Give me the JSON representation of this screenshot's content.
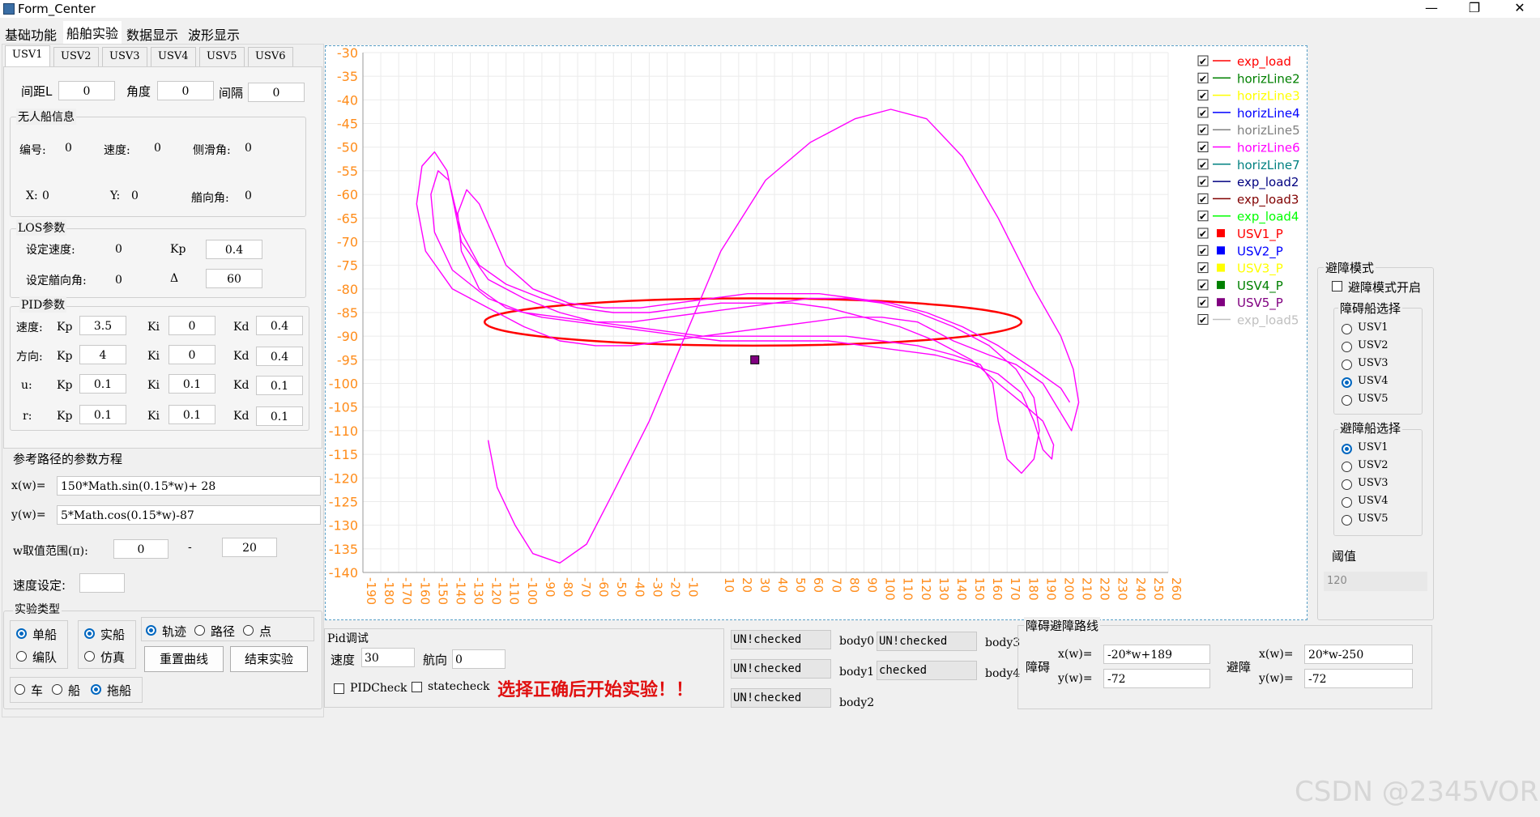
{
  "window": {
    "title": "Form_Center",
    "minimize": "—",
    "maximize": "❐",
    "close": "✕"
  },
  "menu": [
    "基础功能",
    "船舶实验",
    "数据显示",
    "波形显示"
  ],
  "usv_tabs": [
    "USV1",
    "USV2",
    "USV3",
    "USV4",
    "USV5",
    "USV6"
  ],
  "spacing": {
    "l_label": "间距L",
    "l_value": "0",
    "angle_label": "角度",
    "angle_value": "0",
    "interval_label": "间隔",
    "interval_value": "0"
  },
  "usv_info": {
    "title": "无人船信息",
    "id_label": "编号:",
    "id_value": "0",
    "speed_label": "速度:",
    "speed_value": "0",
    "slip_label": "侧滑角:",
    "slip_value": "0",
    "x_label": "X:",
    "x_value": "0",
    "y_label": "Y:",
    "y_value": "0",
    "heading_label": "艏向角:",
    "heading_value": "0"
  },
  "los": {
    "title": "LOS参数",
    "set_speed_label": "设定速度:",
    "set_speed_value": "0",
    "kp_label": "Kp",
    "kp_value": "0.4",
    "set_heading_label": "设定艏向角:",
    "set_heading_value": "0",
    "delta_label": "Δ",
    "delta_value": "60"
  },
  "pid": {
    "title": "PID参数",
    "rows": [
      {
        "name": "速度:",
        "kp": "3.5",
        "ki": "0",
        "kd": "0.4"
      },
      {
        "name": "方向:",
        "kp": "4",
        "ki": "0",
        "kd": "0.4"
      },
      {
        "name": "u:",
        "kp": "0.1",
        "ki": "0.1",
        "kd": "0.1"
      },
      {
        "name": "r:",
        "kp": "0.1",
        "ki": "0.1",
        "kd": "0.1"
      }
    ],
    "kp_label": "Kp",
    "ki_label": "Ki",
    "kd_label": "Kd"
  },
  "ref_path": {
    "title": "参考路径的参数方程",
    "x_label": "x(w)=",
    "x_value": "150*Math.sin(0.15*w)+ 28",
    "y_label": "y(w)=",
    "y_value": "5*Math.cos(0.15*w)-87",
    "w_label": "w取值范围(π):",
    "w_from": "0",
    "w_dash": "-",
    "w_to": "20",
    "speed_label": "速度设定:",
    "speed_value": ""
  },
  "exp_type": {
    "title": "实验类型",
    "single": "单船",
    "formation": "编队",
    "real": "实船",
    "sim": "仿真",
    "trajectory": "轨迹",
    "path": "路径",
    "point": "点",
    "reset_button": "重置曲线",
    "end_button": "结束实验",
    "car": "车",
    "ship": "船",
    "tug": "拖船"
  },
  "pid_debug": {
    "title": "Pid调试",
    "speed_label": "速度",
    "speed_value": "30",
    "heading_label": "航向",
    "heading_value": "0",
    "pidcheck": "PIDCheck",
    "statecheck": "statecheck",
    "warning": "选择正确后开始实验！！"
  },
  "bodies": [
    {
      "status": "UN!checked",
      "label": "body0"
    },
    {
      "status": "UN!checked",
      "label": "body1"
    },
    {
      "status": "UN!checked",
      "label": "body2"
    },
    {
      "status": "UN!checked",
      "label": "body3"
    },
    {
      "status": "checked",
      "label": "body4"
    }
  ],
  "obstacle_path": {
    "title": "障碍避障路线",
    "obs_label": "障碍",
    "obs_x_label": "x(w)=",
    "obs_x_value": "-20*w+189",
    "obs_y_label": "y(w)=",
    "obs_y_value": "-72",
    "avoid_label": "避障",
    "avoid_x_label": "x(w)=",
    "avoid_x_value": "20*w-250",
    "avoid_y_label": "y(w)=",
    "avoid_y_value": "-72"
  },
  "avoid_mode": {
    "title": "避障模式",
    "enable": "避障模式开启",
    "obstacle_ship_title": "障碍船选择",
    "obstacle_ships": [
      "USV1",
      "USV2",
      "USV3",
      "USV4",
      "USV5"
    ],
    "obstacle_selected": 3,
    "avoid_ship_title": "避障船选择",
    "avoid_ships": [
      "USV1",
      "USV2",
      "USV3",
      "USV4",
      "USV5"
    ],
    "avoid_selected": 0,
    "threshold_label": "阈值",
    "threshold_value": "120"
  },
  "watermark": "CSDN @2345VOR",
  "chart_data": {
    "type": "line",
    "xlim": [
      -190,
      260
    ],
    "ylim": [
      -140,
      -30
    ],
    "x_ticks": [
      -190,
      -180,
      -170,
      -160,
      -150,
      -140,
      -130,
      -120,
      -110,
      -100,
      -90,
      -80,
      -70,
      -60,
      -50,
      -40,
      -30,
      -20,
      -10,
      10,
      20,
      30,
      40,
      50,
      60,
      70,
      80,
      90,
      100,
      110,
      120,
      130,
      140,
      150,
      160,
      170,
      180,
      190,
      200,
      210,
      220,
      230,
      240,
      250,
      260
    ],
    "y_ticks": [
      -30,
      -35,
      -40,
      -45,
      -50,
      -55,
      -60,
      -65,
      -70,
      -75,
      -80,
      -85,
      -90,
      -95,
      -100,
      -105,
      -110,
      -115,
      -120,
      -125,
      -130,
      -135,
      -140
    ],
    "tick_color": "#ff8c1a",
    "legend": [
      {
        "name": "exp_load",
        "color": "#ff0000",
        "kind": "line"
      },
      {
        "name": "horizLine2",
        "color": "#008000",
        "kind": "line"
      },
      {
        "name": "horizLine3",
        "color": "#ffff00",
        "kind": "line"
      },
      {
        "name": "horizLine4",
        "color": "#0000ff",
        "kind": "line"
      },
      {
        "name": "horizLine5",
        "color": "#808080",
        "kind": "line"
      },
      {
        "name": "horizLine6",
        "color": "#ff00ff",
        "kind": "line"
      },
      {
        "name": "horizLine7",
        "color": "#008080",
        "kind": "line"
      },
      {
        "name": "exp_load2",
        "color": "#000080",
        "kind": "line"
      },
      {
        "name": "exp_load3",
        "color": "#800000",
        "kind": "line"
      },
      {
        "name": "exp_load4",
        "color": "#00ff00",
        "kind": "line"
      },
      {
        "name": "USV1_P",
        "color": "#ff0000",
        "kind": "box"
      },
      {
        "name": "USV2_P",
        "color": "#0000ff",
        "kind": "box"
      },
      {
        "name": "USV3_P",
        "color": "#ffff00",
        "kind": "box"
      },
      {
        "name": "USV4_P",
        "color": "#008000",
        "kind": "box"
      },
      {
        "name": "USV5_P",
        "color": "#800080",
        "kind": "box"
      },
      {
        "name": "exp_load5",
        "color": "#c0c0c0",
        "kind": "line"
      }
    ],
    "series": [
      {
        "name": "exp_load",
        "color": "#ff0000",
        "shape": "ellipse",
        "center": [
          28,
          -87
        ],
        "rx": 150,
        "ry": 5
      },
      {
        "name": "horizLine6",
        "color": "#ff00ff",
        "points": [
          [
            -120,
            -112
          ],
          [
            -115,
            -122
          ],
          [
            -105,
            -130
          ],
          [
            -95,
            -136
          ],
          [
            -80,
            -138
          ],
          [
            -65,
            -134
          ],
          [
            -50,
            -123
          ],
          [
            -30,
            -108
          ],
          [
            -10,
            -90
          ],
          [
            10,
            -72
          ],
          [
            35,
            -57
          ],
          [
            60,
            -49
          ],
          [
            85,
            -44
          ],
          [
            105,
            -42
          ],
          [
            125,
            -44
          ],
          [
            145,
            -52
          ],
          [
            165,
            -65
          ],
          [
            185,
            -80
          ],
          [
            200,
            -90
          ],
          [
            207,
            -97
          ],
          [
            210,
            -104
          ],
          [
            206,
            -110
          ],
          [
            198,
            -105
          ],
          [
            190,
            -100
          ],
          [
            175,
            -96
          ],
          [
            160,
            -94
          ],
          [
            140,
            -91
          ],
          [
            120,
            -87
          ],
          [
            100,
            -86
          ],
          [
            80,
            -86
          ],
          [
            60,
            -87
          ],
          [
            40,
            -88
          ],
          [
            20,
            -89
          ],
          [
            0,
            -90
          ],
          [
            -20,
            -91
          ],
          [
            -40,
            -92
          ],
          [
            -60,
            -92
          ],
          [
            -80,
            -91
          ],
          [
            -100,
            -88
          ],
          [
            -120,
            -84
          ],
          [
            -140,
            -80
          ],
          [
            -155,
            -72
          ],
          [
            -160,
            -62
          ],
          [
            -157,
            -54
          ],
          [
            -150,
            -51
          ],
          [
            -143,
            -55
          ],
          [
            -135,
            -70
          ],
          [
            -120,
            -78
          ],
          [
            -100,
            -82
          ],
          [
            -80,
            -85
          ],
          [
            -60,
            -87
          ],
          [
            -40,
            -87
          ],
          [
            -20,
            -86
          ],
          [
            0,
            -85
          ],
          [
            20,
            -84
          ],
          [
            40,
            -83
          ],
          [
            60,
            -82
          ],
          [
            80,
            -82
          ],
          [
            100,
            -83
          ],
          [
            120,
            -85
          ],
          [
            140,
            -88
          ],
          [
            160,
            -92
          ],
          [
            175,
            -97
          ],
          [
            185,
            -103
          ],
          [
            188,
            -110
          ],
          [
            185,
            -116
          ],
          [
            178,
            -119
          ],
          [
            170,
            -116
          ],
          [
            165,
            -108
          ],
          [
            162,
            -100
          ],
          [
            155,
            -96
          ],
          [
            140,
            -94
          ],
          [
            120,
            -92
          ],
          [
            100,
            -91
          ],
          [
            80,
            -90
          ],
          [
            60,
            -90
          ],
          [
            40,
            -90
          ],
          [
            20,
            -90
          ],
          [
            0,
            -90
          ],
          [
            -20,
            -89
          ],
          [
            -40,
            -88
          ],
          [
            -60,
            -87
          ],
          [
            -80,
            -86
          ],
          [
            -100,
            -85
          ],
          [
            -120,
            -82
          ],
          [
            -140,
            -76
          ],
          [
            -150,
            -68
          ],
          [
            -152,
            -60
          ],
          [
            -148,
            -55
          ],
          [
            -142,
            -57
          ],
          [
            -135,
            -68
          ],
          [
            -125,
            -75
          ],
          [
            -110,
            -79
          ],
          [
            -90,
            -82
          ],
          [
            -70,
            -84
          ],
          [
            -50,
            -85
          ],
          [
            -30,
            -85
          ],
          [
            -10,
            -84
          ],
          [
            10,
            -83
          ],
          [
            30,
            -83
          ],
          [
            50,
            -83
          ],
          [
            70,
            -84
          ],
          [
            90,
            -86
          ],
          [
            110,
            -88
          ],
          [
            130,
            -91
          ],
          [
            150,
            -95
          ],
          [
            165,
            -100
          ],
          [
            178,
            -104
          ],
          [
            190,
            -108
          ],
          [
            196,
            -113
          ],
          [
            195,
            -116
          ],
          [
            190,
            -114
          ],
          [
            185,
            -108
          ],
          [
            178,
            -102
          ],
          [
            165,
            -98
          ],
          [
            150,
            -96
          ],
          [
            130,
            -94
          ],
          [
            110,
            -93
          ],
          [
            90,
            -92
          ],
          [
            70,
            -91
          ],
          [
            50,
            -91
          ],
          [
            30,
            -91
          ],
          [
            10,
            -91
          ],
          [
            -10,
            -90
          ],
          [
            -30,
            -89
          ],
          [
            -50,
            -88
          ],
          [
            -70,
            -87
          ],
          [
            -90,
            -86
          ],
          [
            -110,
            -84
          ],
          [
            -125,
            -80
          ],
          [
            -135,
            -72
          ],
          [
            -137,
            -64
          ],
          [
            -132,
            -59
          ],
          [
            -125,
            -62
          ],
          [
            -118,
            -68
          ],
          [
            -110,
            -75
          ],
          [
            -95,
            -80
          ],
          [
            -75,
            -83
          ],
          [
            -55,
            -84
          ],
          [
            -35,
            -84
          ],
          [
            -15,
            -83
          ],
          [
            5,
            -82
          ],
          [
            25,
            -81
          ],
          [
            45,
            -81
          ],
          [
            65,
            -81
          ],
          [
            85,
            -82
          ],
          [
            105,
            -83
          ],
          [
            125,
            -85
          ],
          [
            145,
            -88
          ],
          [
            165,
            -92
          ],
          [
            185,
            -97
          ],
          [
            200,
            -101
          ],
          [
            205,
            -104
          ]
        ]
      }
    ],
    "markers": [
      {
        "name": "USV5_P",
        "x": 29,
        "y": -95,
        "color": "#800080"
      }
    ]
  }
}
